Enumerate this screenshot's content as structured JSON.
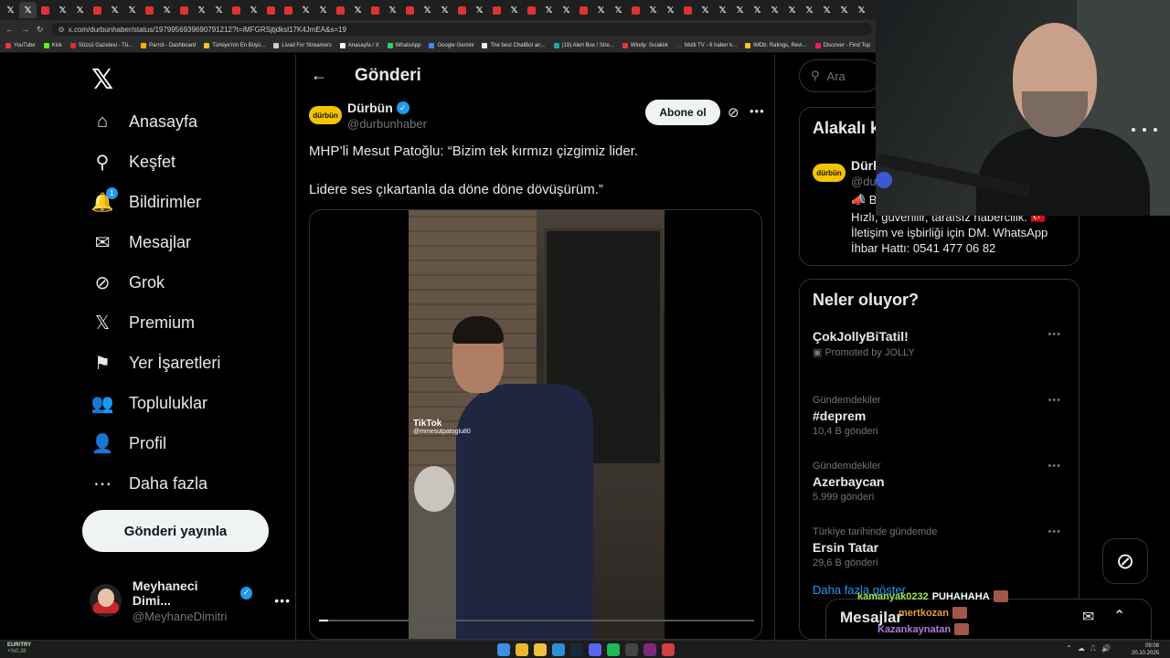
{
  "browser": {
    "url": "x.com/durbunhaber/status/1979956939690791212?t=iMFGRSjtjdksl17K4JmEA&s=19",
    "bookmarks": [
      {
        "label": "YouTube",
        "color": "#e53935"
      },
      {
        "label": "Kick",
        "color": "#53fc18"
      },
      {
        "label": "Sözcü Gazetesi - Tü...",
        "color": "#d32f2f"
      },
      {
        "label": "Parrot - Dashboard",
        "color": "#ffb300"
      },
      {
        "label": "Türkiye'nin En Büyü...",
        "color": "#fbc02d"
      },
      {
        "label": "Livad For Streamers",
        "color": "#cccccc"
      },
      {
        "label": "Anasayfa / X",
        "color": "#ffffff"
      },
      {
        "label": "WhatsApp",
        "color": "#25d366"
      },
      {
        "label": "Google Gemini",
        "color": "#4285f4"
      },
      {
        "label": "The best ChatBot an...",
        "color": "#eeeeee"
      },
      {
        "label": "(19) Alert Box / Stre...",
        "color": "#26a69a"
      },
      {
        "label": "Windy: Sıcaklık",
        "color": "#e53935"
      },
      {
        "label": "Multi TV - 6 haber k...",
        "color": "#333333"
      },
      {
        "label": "IMDb: Ratings, Revi...",
        "color": "#f5c518"
      },
      {
        "label": "Discover - Find Top",
        "color": "#e91e63"
      }
    ]
  },
  "nav": {
    "items": [
      {
        "label": "Anasayfa",
        "icon": "home-icon",
        "glyph": "⌂"
      },
      {
        "label": "Keşfet",
        "icon": "search-icon",
        "glyph": "⚲"
      },
      {
        "label": "Bildirimler",
        "icon": "bell-icon",
        "glyph": "🔔",
        "badge": "1"
      },
      {
        "label": "Mesajlar",
        "icon": "mail-icon",
        "glyph": "✉"
      },
      {
        "label": "Grok",
        "icon": "grok-icon",
        "glyph": "⊘"
      },
      {
        "label": "Premium",
        "icon": "x-premium-icon",
        "glyph": "𝕏"
      },
      {
        "label": "Yer İşaretleri",
        "icon": "bookmark-icon",
        "glyph": "⚑"
      },
      {
        "label": "Topluluklar",
        "icon": "communities-icon",
        "glyph": "👥"
      },
      {
        "label": "Profil",
        "icon": "profile-icon",
        "glyph": "👤"
      },
      {
        "label": "Daha fazla",
        "icon": "more-circle-icon",
        "glyph": "⋯"
      }
    ],
    "post_button": "Gönderi yayınla",
    "profile": {
      "name": "Meyhaneci Dimi...",
      "handle": "@MeyhaneDimitri"
    }
  },
  "main": {
    "title": "Gönderi",
    "author": {
      "name": "Dürbün",
      "handle": "@durbunhaber",
      "logo_text": "dürbün"
    },
    "subscribe": "Abone ol",
    "text_line1": "MHP’li Mesut Patoğlu: “Bizim tek kırmızı çizgimiz lider.",
    "text_line2": "Lidere ses çıkartanla da döne döne dövüşürüm.”",
    "video": {
      "watermark": "TikTok",
      "watermark_handle": "@mmesutpatoglu80",
      "progress": 0.02
    }
  },
  "sidebar": {
    "search_placeholder": "Ara",
    "related": {
      "title": "Alakalı k",
      "name": "Dürb",
      "handle": "@du",
      "bio1": "📣 B",
      "bio2": "Hızlı, güvenilir, tarafsız habercilik. 🇹🇷",
      "bio3": "İletişim ve işbirliği için DM. WhatsApp",
      "bio4": "İhbar Hattı: 0541 477 06 82"
    },
    "trends_title": "Neler oluyor?",
    "trends": [
      {
        "category": "",
        "name": "ÇokJollyBiTatil!",
        "count": "Promoted by JOLLY"
      },
      {
        "category": "Gündemdekiler",
        "name": "#deprem",
        "count": "10,4 B gönderi"
      },
      {
        "category": "Gündemdekiler",
        "name": "Azerbaycan",
        "count": "5.999 gönderi"
      },
      {
        "category": "Türkiye tarihinde gündemde",
        "name": "Ersin Tatar",
        "count": "29,6 B gönderi"
      }
    ],
    "show_more": "Daha fazla göster"
  },
  "messages_bar": {
    "label": "Mesajlar"
  },
  "chat": [
    {
      "user": "kamanyak0232",
      "msg": "PUHAHAHA",
      "color": "#a4e34a"
    },
    {
      "user": "mertkozan",
      "msg": "",
      "color": "#e0a030"
    },
    {
      "user": "Kazankaynatan",
      "msg": "",
      "color": "#b07ae0"
    }
  ],
  "taskbar": {
    "fx_label": "EUR/TRY",
    "fx_change": "+%0,28",
    "time": "09:08",
    "date": "20.10.2025"
  }
}
